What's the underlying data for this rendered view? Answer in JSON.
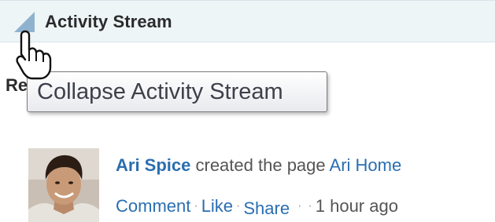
{
  "header": {
    "title": "Activity Stream",
    "toggle_icon": "collapse-triangle-icon",
    "background_color": "#eef5f7"
  },
  "hidden_heading": {
    "visible_text": "Re"
  },
  "tooltip": {
    "text": "Collapse Activity Stream"
  },
  "cursor": {
    "icon": "hand-pointer-icon"
  },
  "activity": {
    "avatar_icon": "user-avatar-photo",
    "actor": "Ari Spice",
    "verb": "created the page",
    "target": "Ari Home",
    "actions": {
      "comment": "Comment",
      "like": "Like",
      "share": "Share"
    },
    "separator": "·",
    "timestamp": "1 hour ago",
    "link_color": "#2a6eb0"
  }
}
